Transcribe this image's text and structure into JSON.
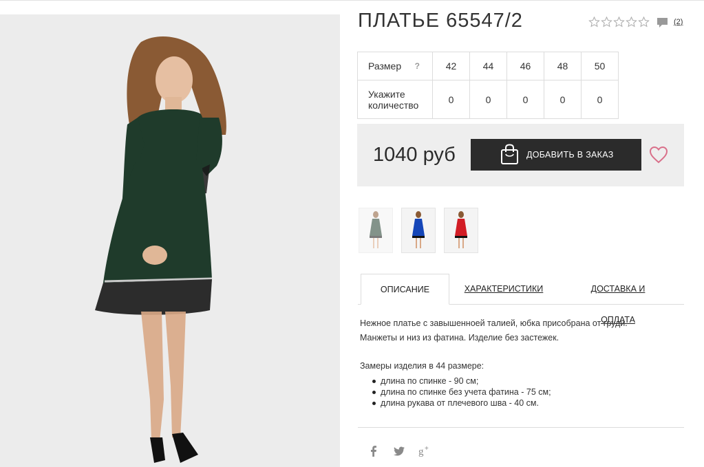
{
  "product": {
    "title": "ПЛАТЬЕ 65547/2",
    "rating_stars": 5,
    "rating_filled": 0,
    "comment_count": "(2)"
  },
  "sizes": {
    "size_label": "Размер",
    "help": "?",
    "quantity_label": "Укажите количество",
    "columns": [
      "42",
      "44",
      "46",
      "48",
      "50"
    ],
    "quantities": [
      "0",
      "0",
      "0",
      "0",
      "0"
    ]
  },
  "purchase": {
    "price": "1040 руб",
    "add_button_label": "ДОБАВИТЬ В ЗАКАЗ"
  },
  "thumbnails": [
    {
      "name": "green",
      "color": "#1f3b2b"
    },
    {
      "name": "blue",
      "color": "#1546b8"
    },
    {
      "name": "red",
      "color": "#d21d25"
    }
  ],
  "tabs": [
    {
      "label": "ОПИСАНИЕ",
      "active": true
    },
    {
      "label": "ХАРАКТЕРИСТИКИ",
      "active": false
    },
    {
      "label": "ДОСТАВКА И ОПЛАТА",
      "active": false
    }
  ],
  "description": {
    "line1": "Нежное платье с завышенноей талией, юбка присобрана от груди.",
    "line2": "Манжеты и низ из фатина. Изделие без застежек.",
    "measures_title": "Замеры изделия в 44 размере:",
    "measures": [
      "длина по спинке - 90 см;",
      "длина по спинке без учета фатина - 75 см;",
      "длина рукава от плечевого шва - 40 см."
    ]
  },
  "social": [
    "facebook-icon",
    "twitter-icon",
    "google-plus-icon"
  ],
  "colors": {
    "dress_green": "#1f3b2b",
    "button_dark": "#2b2b2b",
    "heart": "#d9708a",
    "price_box_bg": "#eeeeee"
  }
}
